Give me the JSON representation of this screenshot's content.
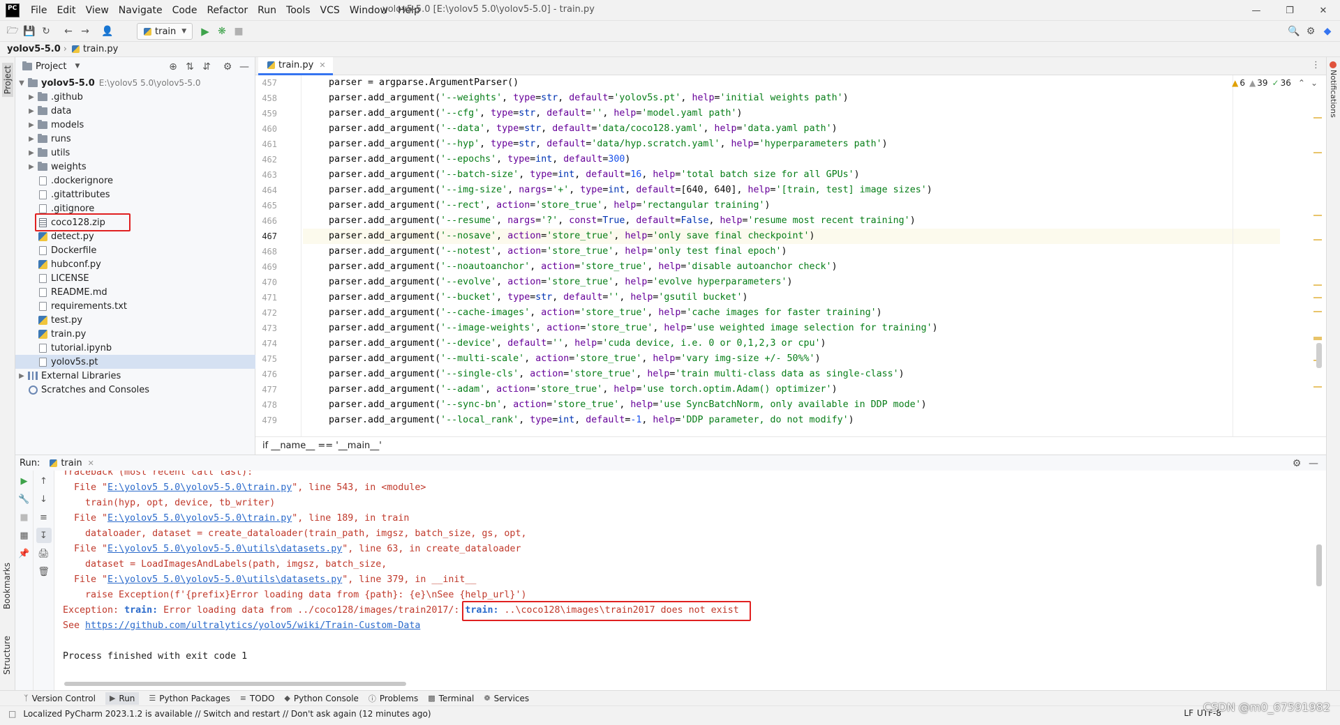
{
  "app": {
    "logo_text": "PC",
    "window_title": "yolov5-5.0 [E:\\yolov5 5.0\\yolov5-5.0] - train.py",
    "menu": [
      "File",
      "Edit",
      "View",
      "Navigate",
      "Code",
      "Refactor",
      "Run",
      "Tools",
      "VCS",
      "Window",
      "Help"
    ]
  },
  "toolbar": {
    "run_config": "train"
  },
  "navbar": {
    "project": "yolov5-5.0",
    "file": "train.py"
  },
  "left_strip": {
    "project": "Project",
    "bookmarks": "Bookmarks",
    "structure": "Structure"
  },
  "right_strip": {
    "notifications": "Notifications"
  },
  "project_panel": {
    "title": "Project",
    "root": {
      "name": "yolov5-5.0",
      "path": "E:\\yolov5 5.0\\yolov5-5.0"
    },
    "items": [
      {
        "name": ".github",
        "kind": "folder"
      },
      {
        "name": "data",
        "kind": "folder"
      },
      {
        "name": "models",
        "kind": "folder"
      },
      {
        "name": "runs",
        "kind": "folder"
      },
      {
        "name": "utils",
        "kind": "folder"
      },
      {
        "name": "weights",
        "kind": "folder"
      },
      {
        "name": ".dockerignore",
        "kind": "file"
      },
      {
        "name": ".gitattributes",
        "kind": "file"
      },
      {
        "name": ".gitignore",
        "kind": "file"
      },
      {
        "name": "coco128.zip",
        "kind": "zip"
      },
      {
        "name": "detect.py",
        "kind": "py"
      },
      {
        "name": "Dockerfile",
        "kind": "file"
      },
      {
        "name": "hubconf.py",
        "kind": "py"
      },
      {
        "name": "LICENSE",
        "kind": "file"
      },
      {
        "name": "README.md",
        "kind": "file"
      },
      {
        "name": "requirements.txt",
        "kind": "file"
      },
      {
        "name": "test.py",
        "kind": "py"
      },
      {
        "name": "train.py",
        "kind": "py"
      },
      {
        "name": "tutorial.ipynb",
        "kind": "file"
      },
      {
        "name": "yolov5s.pt",
        "kind": "file"
      }
    ],
    "external_libraries": "External Libraries",
    "scratches": "Scratches and Consoles"
  },
  "editor": {
    "tab": "train.py",
    "inspections": {
      "warnings": "6",
      "weak_warnings": "39",
      "typos": "36"
    },
    "breadcrumb": "if __name__ == '__main__'",
    "current_line": "467",
    "lines": [
      {
        "no": "457",
        "text": "parser = argparse.ArgumentParser()"
      },
      {
        "no": "458",
        "text": "parser.add_argument('--weights', type=str, default='yolov5s.pt', help='initial weights path')"
      },
      {
        "no": "459",
        "text": "parser.add_argument('--cfg', type=str, default='', help='model.yaml path')"
      },
      {
        "no": "460",
        "text": "parser.add_argument('--data', type=str, default='data/coco128.yaml', help='data.yaml path')"
      },
      {
        "no": "461",
        "text": "parser.add_argument('--hyp', type=str, default='data/hyp.scratch.yaml', help='hyperparameters path')"
      },
      {
        "no": "462",
        "text": "parser.add_argument('--epochs', type=int, default=300)"
      },
      {
        "no": "463",
        "text": "parser.add_argument('--batch-size', type=int, default=16, help='total batch size for all GPUs')"
      },
      {
        "no": "464",
        "text": "parser.add_argument('--img-size', nargs='+', type=int, default=[640, 640], help='[train, test] image sizes')"
      },
      {
        "no": "465",
        "text": "parser.add_argument('--rect', action='store_true', help='rectangular training')"
      },
      {
        "no": "466",
        "text": "parser.add_argument('--resume', nargs='?', const=True, default=False, help='resume most recent training')"
      },
      {
        "no": "467",
        "text": "parser.add_argument('--nosave', action='store_true', help='only save final checkpoint')"
      },
      {
        "no": "468",
        "text": "parser.add_argument('--notest', action='store_true', help='only test final epoch')"
      },
      {
        "no": "469",
        "text": "parser.add_argument('--noautoanchor', action='store_true', help='disable autoanchor check')"
      },
      {
        "no": "470",
        "text": "parser.add_argument('--evolve', action='store_true', help='evolve hyperparameters')"
      },
      {
        "no": "471",
        "text": "parser.add_argument('--bucket', type=str, default='', help='gsutil bucket')"
      },
      {
        "no": "472",
        "text": "parser.add_argument('--cache-images', action='store_true', help='cache images for faster training')"
      },
      {
        "no": "473",
        "text": "parser.add_argument('--image-weights', action='store_true', help='use weighted image selection for training')"
      },
      {
        "no": "474",
        "text": "parser.add_argument('--device', default='', help='cuda device, i.e. 0 or 0,1,2,3 or cpu')"
      },
      {
        "no": "475",
        "text": "parser.add_argument('--multi-scale', action='store_true', help='vary img-size +/- 50%%')"
      },
      {
        "no": "476",
        "text": "parser.add_argument('--single-cls', action='store_true', help='train multi-class data as single-class')"
      },
      {
        "no": "477",
        "text": "parser.add_argument('--adam', action='store_true', help='use torch.optim.Adam() optimizer')"
      },
      {
        "no": "478",
        "text": "parser.add_argument('--sync-bn', action='store_true', help='use SyncBatchNorm, only available in DDP mode')"
      },
      {
        "no": "479",
        "text": "parser.add_argument('--local_rank', type=int, default=-1, help='DDP parameter, do not modify')"
      }
    ]
  },
  "run_panel": {
    "label": "Run:",
    "tab": "train",
    "console": {
      "traceback": "Traceback (most recent call last):",
      "f1_pre": "  File \"",
      "f1_link": "E:\\yolov5 5.0\\yolov5-5.0\\train.py",
      "f1_post": "\", line 543, in <module>",
      "f1_code": "    train(hyp, opt, device, tb_writer)",
      "f2_pre": "  File \"",
      "f2_link": "E:\\yolov5 5.0\\yolov5-5.0\\train.py",
      "f2_post": "\", line 189, in train",
      "f2_code": "    dataloader, dataset = create_dataloader(train_path, imgsz, batch_size, gs, opt,",
      "f3_pre": "  File \"",
      "f3_link": "E:\\yolov5 5.0\\yolov5-5.0\\utils\\datasets.py",
      "f3_post": "\", line 63, in create_dataloader",
      "f3_code": "    dataset = LoadImagesAndLabels(path, imgsz, batch_size,",
      "f4_pre": "  File \"",
      "f4_link": "E:\\yolov5 5.0\\yolov5-5.0\\utils\\datasets.py",
      "f4_post": "\", line 379, in __init__",
      "f4_code": "    raise Exception(f'{prefix}Error loading data from {path}: {e}\\nSee {help_url}')",
      "exc_pre": "Exception: ",
      "exc_train1": "train:",
      "exc_mid": " Error loading data from ../coco128/images/train2017/: ",
      "exc_train2": "train:",
      "exc_tail": " ..\\coco128\\images\\train2017 does not exist",
      "see_pre": "See ",
      "see_link": "https://github.com/ultralytics/yolov5/wiki/Train-Custom-Data",
      "finished": "Process finished with exit code 1"
    }
  },
  "bottom_tabs": [
    "Version Control",
    "Run",
    "Python Packages",
    "TODO",
    "Python Console",
    "Problems",
    "Terminal",
    "Services"
  ],
  "status": {
    "message": "Localized PyCharm 2023.1.2 is available // Switch and restart // Don't ask again (12 minutes ago)",
    "line_sep": "LF",
    "encoding": "UTF-8",
    "watermark": "CSDN @m0_67591982"
  },
  "colors": {
    "accent": "#3574f0",
    "error_text": "#c0392b",
    "highlight_box": "#e02020",
    "string": "#067d17",
    "keyword": "#0033b3"
  }
}
